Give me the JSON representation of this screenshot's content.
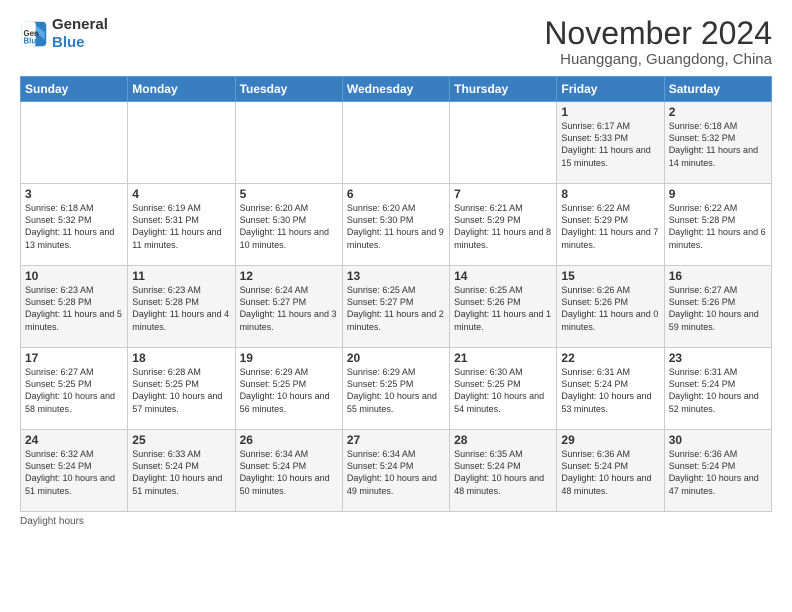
{
  "logo": {
    "line1": "General",
    "line2": "Blue"
  },
  "title": "November 2024",
  "location": "Huanggang, Guangdong, China",
  "days_of_week": [
    "Sunday",
    "Monday",
    "Tuesday",
    "Wednesday",
    "Thursday",
    "Friday",
    "Saturday"
  ],
  "weeks": [
    [
      {
        "day": "",
        "info": ""
      },
      {
        "day": "",
        "info": ""
      },
      {
        "day": "",
        "info": ""
      },
      {
        "day": "",
        "info": ""
      },
      {
        "day": "",
        "info": ""
      },
      {
        "day": "1",
        "info": "Sunrise: 6:17 AM\nSunset: 5:33 PM\nDaylight: 11 hours and 15 minutes."
      },
      {
        "day": "2",
        "info": "Sunrise: 6:18 AM\nSunset: 5:32 PM\nDaylight: 11 hours and 14 minutes."
      }
    ],
    [
      {
        "day": "3",
        "info": "Sunrise: 6:18 AM\nSunset: 5:32 PM\nDaylight: 11 hours and 13 minutes."
      },
      {
        "day": "4",
        "info": "Sunrise: 6:19 AM\nSunset: 5:31 PM\nDaylight: 11 hours and 11 minutes."
      },
      {
        "day": "5",
        "info": "Sunrise: 6:20 AM\nSunset: 5:30 PM\nDaylight: 11 hours and 10 minutes."
      },
      {
        "day": "6",
        "info": "Sunrise: 6:20 AM\nSunset: 5:30 PM\nDaylight: 11 hours and 9 minutes."
      },
      {
        "day": "7",
        "info": "Sunrise: 6:21 AM\nSunset: 5:29 PM\nDaylight: 11 hours and 8 minutes."
      },
      {
        "day": "8",
        "info": "Sunrise: 6:22 AM\nSunset: 5:29 PM\nDaylight: 11 hours and 7 minutes."
      },
      {
        "day": "9",
        "info": "Sunrise: 6:22 AM\nSunset: 5:28 PM\nDaylight: 11 hours and 6 minutes."
      }
    ],
    [
      {
        "day": "10",
        "info": "Sunrise: 6:23 AM\nSunset: 5:28 PM\nDaylight: 11 hours and 5 minutes."
      },
      {
        "day": "11",
        "info": "Sunrise: 6:23 AM\nSunset: 5:28 PM\nDaylight: 11 hours and 4 minutes."
      },
      {
        "day": "12",
        "info": "Sunrise: 6:24 AM\nSunset: 5:27 PM\nDaylight: 11 hours and 3 minutes."
      },
      {
        "day": "13",
        "info": "Sunrise: 6:25 AM\nSunset: 5:27 PM\nDaylight: 11 hours and 2 minutes."
      },
      {
        "day": "14",
        "info": "Sunrise: 6:25 AM\nSunset: 5:26 PM\nDaylight: 11 hours and 1 minute."
      },
      {
        "day": "15",
        "info": "Sunrise: 6:26 AM\nSunset: 5:26 PM\nDaylight: 11 hours and 0 minutes."
      },
      {
        "day": "16",
        "info": "Sunrise: 6:27 AM\nSunset: 5:26 PM\nDaylight: 10 hours and 59 minutes."
      }
    ],
    [
      {
        "day": "17",
        "info": "Sunrise: 6:27 AM\nSunset: 5:25 PM\nDaylight: 10 hours and 58 minutes."
      },
      {
        "day": "18",
        "info": "Sunrise: 6:28 AM\nSunset: 5:25 PM\nDaylight: 10 hours and 57 minutes."
      },
      {
        "day": "19",
        "info": "Sunrise: 6:29 AM\nSunset: 5:25 PM\nDaylight: 10 hours and 56 minutes."
      },
      {
        "day": "20",
        "info": "Sunrise: 6:29 AM\nSunset: 5:25 PM\nDaylight: 10 hours and 55 minutes."
      },
      {
        "day": "21",
        "info": "Sunrise: 6:30 AM\nSunset: 5:25 PM\nDaylight: 10 hours and 54 minutes."
      },
      {
        "day": "22",
        "info": "Sunrise: 6:31 AM\nSunset: 5:24 PM\nDaylight: 10 hours and 53 minutes."
      },
      {
        "day": "23",
        "info": "Sunrise: 6:31 AM\nSunset: 5:24 PM\nDaylight: 10 hours and 52 minutes."
      }
    ],
    [
      {
        "day": "24",
        "info": "Sunrise: 6:32 AM\nSunset: 5:24 PM\nDaylight: 10 hours and 51 minutes."
      },
      {
        "day": "25",
        "info": "Sunrise: 6:33 AM\nSunset: 5:24 PM\nDaylight: 10 hours and 51 minutes."
      },
      {
        "day": "26",
        "info": "Sunrise: 6:34 AM\nSunset: 5:24 PM\nDaylight: 10 hours and 50 minutes."
      },
      {
        "day": "27",
        "info": "Sunrise: 6:34 AM\nSunset: 5:24 PM\nDaylight: 10 hours and 49 minutes."
      },
      {
        "day": "28",
        "info": "Sunrise: 6:35 AM\nSunset: 5:24 PM\nDaylight: 10 hours and 48 minutes."
      },
      {
        "day": "29",
        "info": "Sunrise: 6:36 AM\nSunset: 5:24 PM\nDaylight: 10 hours and 48 minutes."
      },
      {
        "day": "30",
        "info": "Sunrise: 6:36 AM\nSunset: 5:24 PM\nDaylight: 10 hours and 47 minutes."
      }
    ]
  ],
  "footer": {
    "daylight_label": "Daylight hours"
  }
}
